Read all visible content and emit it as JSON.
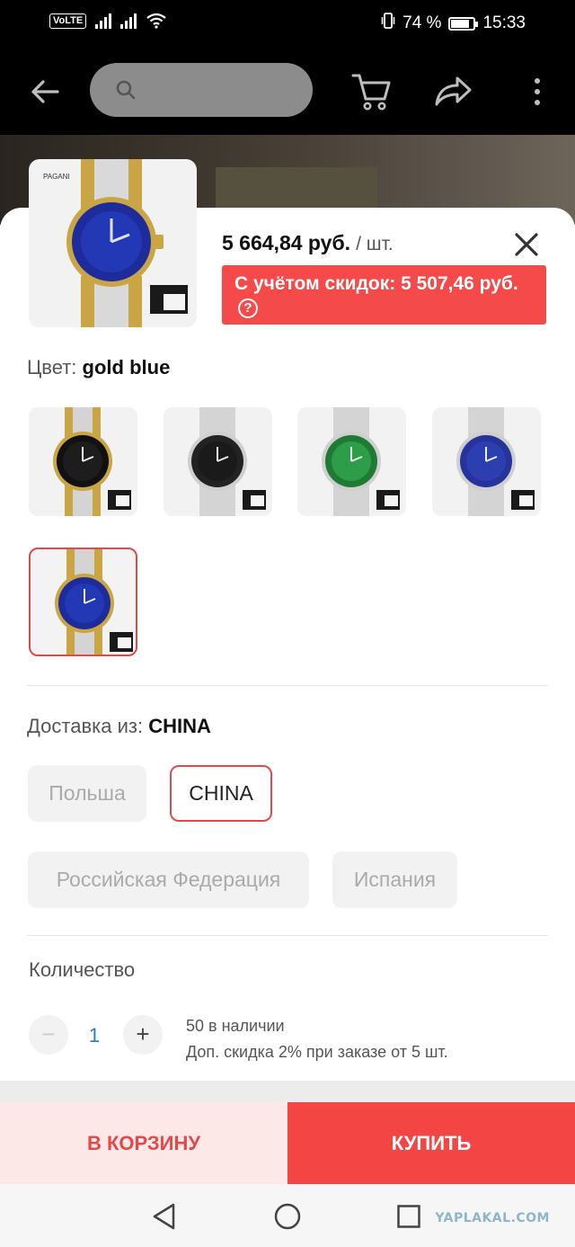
{
  "status_bar": {
    "volte": "VoLTE",
    "battery_percent": "74 %",
    "battery_level": 0.74,
    "time": "15:33"
  },
  "top_bar": {
    "back_icon": "arrow-left-icon",
    "search_icon": "search-icon",
    "cart_icon": "cart-icon",
    "share_icon": "share-icon",
    "more_icon": "more-vertical-icon"
  },
  "product": {
    "price": "5 664,84 руб.",
    "unit": "/ шт.",
    "discount_text": "С учётом скидок: 5 507,46 руб.",
    "help_symbol": "?"
  },
  "color": {
    "label": "Цвет:",
    "value": "gold blue",
    "options": [
      {
        "dial": "#1d1d1d",
        "bezel": "#111111",
        "band": "two-tone gold"
      },
      {
        "dial": "#1a1a1a",
        "bezel": "#222222",
        "band": "steel"
      },
      {
        "dial": "#2e9d4a",
        "bezel": "#1f7a35",
        "band": "steel"
      },
      {
        "dial": "#2d3fb0",
        "bezel": "#25339a",
        "band": "steel"
      },
      {
        "dial": "#2338b5",
        "bezel": "#1d2c9a",
        "band": "two-tone gold",
        "selected": true
      }
    ]
  },
  "shipping": {
    "label": "Доставка из:",
    "value": "CHINA",
    "options": [
      "Польша",
      "CHINA",
      "Российская Федерация",
      "Испания"
    ],
    "selected": "CHINA"
  },
  "quantity": {
    "label": "Количество",
    "minus": "−",
    "value": "1",
    "plus": "+",
    "stock": "50 в наличии",
    "bulk_discount": "Доп. скидка 2% при заказе от 5 шт."
  },
  "actions": {
    "add_to_cart": "В КОРЗИНУ",
    "buy": "КУПИТЬ"
  },
  "watermark": "YAPLAKAL.COM",
  "colors": {
    "accent": "#f44545",
    "selected_border": "#e24a4a",
    "cart_bg": "#fde8e8"
  }
}
